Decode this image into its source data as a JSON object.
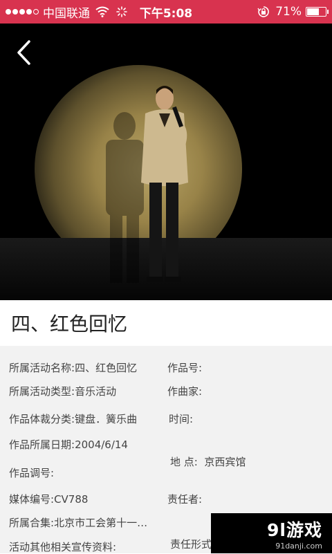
{
  "status_bar": {
    "carrier": "中国联通",
    "time": "下午5:08",
    "battery_percent": "71%",
    "battery_level": 0.71,
    "signal_strength": 4,
    "color": "#d8334f"
  },
  "header": {
    "back_icon": "chevron-left-icon"
  },
  "title": "四、红色回忆",
  "details": {
    "activity_name": {
      "label": "所属活动名称:",
      "value": "四、红色回忆"
    },
    "activity_type": {
      "label": "所属活动类型:",
      "value": "音乐活动"
    },
    "genre": {
      "label": "作品体裁分类:",
      "value": "键盘．簧乐曲"
    },
    "date": {
      "label": "作品所属日期:",
      "value": "2004/6/14"
    },
    "key": {
      "label": "作品调号:",
      "value": ""
    },
    "media_no": {
      "label": "媒体编号:",
      "value": "CV788"
    },
    "collection": {
      "label": "所属合集:",
      "value": "北京市工会第十一…"
    },
    "promo": {
      "label": "活动其他相关宣传资料:",
      "value": ""
    },
    "work_no": {
      "label": "作品号:",
      "value": ""
    },
    "composer": {
      "label": "作曲家:",
      "value": ""
    },
    "time": {
      "label": "时间:",
      "value": ""
    },
    "place": {
      "label": "地 点:",
      "value": "京西宾馆"
    },
    "responsible": {
      "label": "责任者:",
      "value": ""
    },
    "responsibility_form": {
      "label": "责任形式:",
      "value": ""
    }
  },
  "watermark": {
    "main": "9l游戏",
    "sub": "91danji.com"
  }
}
